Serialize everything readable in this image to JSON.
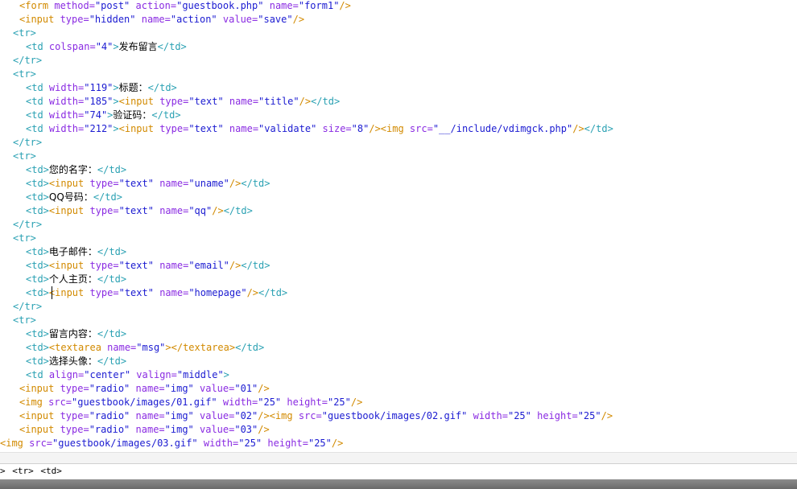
{
  "editor": {
    "lines": [
      [
        [
          "tag",
          "<form "
        ],
        [
          "attr",
          "method="
        ],
        [
          "val",
          "\"post\""
        ],
        [
          "tag",
          " "
        ],
        [
          "attr",
          "action="
        ],
        [
          "val",
          "\"guestbook.php\""
        ],
        [
          "tag",
          " "
        ],
        [
          "attr",
          "name="
        ],
        [
          "val",
          "\"form1\""
        ],
        [
          "tag",
          "/>"
        ]
      ],
      [
        [
          "tag",
          "<input "
        ],
        [
          "attr",
          "type="
        ],
        [
          "val",
          "\"hidden\""
        ],
        [
          "tag",
          " "
        ],
        [
          "attr",
          "name="
        ],
        [
          "val",
          "\"action\""
        ],
        [
          "tag",
          " "
        ],
        [
          "attr",
          "value="
        ],
        [
          "val",
          "\"save\""
        ],
        [
          "tag",
          "/>"
        ]
      ],
      [
        [
          "td",
          "<tr>"
        ]
      ],
      [
        [
          "td",
          "<td "
        ],
        [
          "attr",
          "colspan="
        ],
        [
          "val",
          "\"4\""
        ],
        [
          "td",
          ">"
        ],
        [
          "text",
          "发布留言"
        ],
        [
          "td",
          "</td>"
        ]
      ],
      [
        [
          "td",
          "</tr>"
        ]
      ],
      [
        [
          "td",
          "<tr>"
        ]
      ],
      [
        [
          "td",
          "<td "
        ],
        [
          "attr",
          "width="
        ],
        [
          "val",
          "\"119\""
        ],
        [
          "td",
          ">"
        ],
        [
          "text",
          "标题："
        ],
        [
          "td",
          "</td>"
        ]
      ],
      [
        [
          "td",
          "<td "
        ],
        [
          "attr",
          "width="
        ],
        [
          "val",
          "\"185\""
        ],
        [
          "td",
          ">"
        ],
        [
          "tag",
          "<input "
        ],
        [
          "attr",
          "type="
        ],
        [
          "val",
          "\"text\""
        ],
        [
          "tag",
          " "
        ],
        [
          "attr",
          "name="
        ],
        [
          "val",
          "\"title\""
        ],
        [
          "tag",
          "/>"
        ],
        [
          "td",
          "</td>"
        ]
      ],
      [
        [
          "td",
          "<td "
        ],
        [
          "attr",
          "width="
        ],
        [
          "val",
          "\"74\""
        ],
        [
          "td",
          ">"
        ],
        [
          "text",
          "验证码："
        ],
        [
          "td",
          "</td>"
        ]
      ],
      [
        [
          "td",
          "<td "
        ],
        [
          "attr",
          "width="
        ],
        [
          "val",
          "\"212\""
        ],
        [
          "td",
          ">"
        ],
        [
          "tag",
          "<input "
        ],
        [
          "attr",
          "type="
        ],
        [
          "val",
          "\"text\""
        ],
        [
          "tag",
          " "
        ],
        [
          "attr",
          "name="
        ],
        [
          "val",
          "\"validate\""
        ],
        [
          "tag",
          " "
        ],
        [
          "attr",
          "size="
        ],
        [
          "val",
          "\"8\""
        ],
        [
          "tag",
          "/><img "
        ],
        [
          "attr",
          "src="
        ],
        [
          "val",
          "\"__/include/vdimgck.php\""
        ],
        [
          "tag",
          "/>"
        ],
        [
          "td",
          "</td>"
        ]
      ],
      [
        [
          "td",
          "</tr>"
        ]
      ],
      [
        [
          "td",
          "<tr>"
        ]
      ],
      [
        [
          "td",
          "<td>"
        ],
        [
          "text",
          "您的名字："
        ],
        [
          "td",
          "</td>"
        ]
      ],
      [
        [
          "td",
          "<td>"
        ],
        [
          "tag",
          "<input "
        ],
        [
          "attr",
          "type="
        ],
        [
          "val",
          "\"text\""
        ],
        [
          "tag",
          " "
        ],
        [
          "attr",
          "name="
        ],
        [
          "val",
          "\"uname\""
        ],
        [
          "tag",
          "/>"
        ],
        [
          "td",
          "</td>"
        ]
      ],
      [
        [
          "td",
          "<td>"
        ],
        [
          "text",
          "QQ号码："
        ],
        [
          "td",
          "</td>"
        ]
      ],
      [
        [
          "td",
          "<td>"
        ],
        [
          "tag",
          "<input "
        ],
        [
          "attr",
          "type="
        ],
        [
          "val",
          "\"text\""
        ],
        [
          "tag",
          " "
        ],
        [
          "attr",
          "name="
        ],
        [
          "val",
          "\"qq\""
        ],
        [
          "tag",
          "/>"
        ],
        [
          "td",
          "</td>"
        ]
      ],
      [
        [
          "td",
          "</tr>"
        ]
      ],
      [
        [
          "td",
          "<tr>"
        ]
      ],
      [
        [
          "td",
          "<td>"
        ],
        [
          "text",
          "电子邮件："
        ],
        [
          "td",
          "</td>"
        ]
      ],
      [
        [
          "td",
          "<td>"
        ],
        [
          "tag",
          "<input "
        ],
        [
          "attr",
          "type="
        ],
        [
          "val",
          "\"text\""
        ],
        [
          "tag",
          " "
        ],
        [
          "attr",
          "name="
        ],
        [
          "val",
          "\"email\""
        ],
        [
          "tag",
          "/>"
        ],
        [
          "td",
          "</td>"
        ]
      ],
      [
        [
          "td",
          "<td>"
        ],
        [
          "text",
          "个人主页："
        ],
        [
          "td",
          "</td>"
        ]
      ],
      [
        [
          "td",
          "<td>"
        ],
        [
          "tag",
          "<input "
        ],
        [
          "attr",
          "type="
        ],
        [
          "val",
          "\"text\""
        ],
        [
          "tag",
          " "
        ],
        [
          "attr",
          "name="
        ],
        [
          "val",
          "\"homepage\""
        ],
        [
          "tag",
          "/>"
        ],
        [
          "td",
          "</td>"
        ]
      ],
      [
        [
          "td",
          "</tr>"
        ]
      ],
      [
        [
          "td",
          "<tr>"
        ]
      ],
      [
        [
          "td",
          "<td>"
        ],
        [
          "text",
          "留言内容："
        ],
        [
          "td",
          "</td>"
        ]
      ],
      [
        [
          "td",
          "<td>"
        ],
        [
          "tag",
          "<textarea "
        ],
        [
          "attr",
          "name="
        ],
        [
          "val",
          "\"msg\""
        ],
        [
          "tag",
          "></textarea>"
        ],
        [
          "td",
          "</td>"
        ]
      ],
      [
        [
          "td",
          "<td>"
        ],
        [
          "text",
          "选择头像："
        ],
        [
          "td",
          "</td>"
        ]
      ],
      [
        [
          "td",
          "<td "
        ],
        [
          "attr",
          "align="
        ],
        [
          "val",
          "\"center\""
        ],
        [
          "td",
          " "
        ],
        [
          "attr",
          "valign="
        ],
        [
          "val",
          "\"middle\""
        ],
        [
          "td",
          ">"
        ]
      ],
      [
        [
          "tag",
          "<input "
        ],
        [
          "attr",
          "type="
        ],
        [
          "val",
          "\"radio\""
        ],
        [
          "tag",
          " "
        ],
        [
          "attr",
          "name="
        ],
        [
          "val",
          "\"img\""
        ],
        [
          "tag",
          " "
        ],
        [
          "attr",
          "value="
        ],
        [
          "val",
          "\"01\""
        ],
        [
          "tag",
          "/>"
        ]
      ],
      [
        [
          "tag",
          "<img "
        ],
        [
          "attr",
          "src="
        ],
        [
          "val",
          "\"guestbook/images/01.gif\""
        ],
        [
          "tag",
          " "
        ],
        [
          "attr",
          "width="
        ],
        [
          "val",
          "\"25\""
        ],
        [
          "tag",
          " "
        ],
        [
          "attr",
          "height="
        ],
        [
          "val",
          "\"25\""
        ],
        [
          "tag",
          "/>"
        ]
      ],
      [
        [
          "tag",
          "<input "
        ],
        [
          "attr",
          "type="
        ],
        [
          "val",
          "\"radio\""
        ],
        [
          "tag",
          " "
        ],
        [
          "attr",
          "name="
        ],
        [
          "val",
          "\"img\""
        ],
        [
          "tag",
          " "
        ],
        [
          "attr",
          "value="
        ],
        [
          "val",
          "\"02\""
        ],
        [
          "tag",
          "/><img "
        ],
        [
          "attr",
          "src="
        ],
        [
          "val",
          "\"guestbook/images/02.gif\""
        ],
        [
          "tag",
          " "
        ],
        [
          "attr",
          "width="
        ],
        [
          "val",
          "\"25\""
        ],
        [
          "tag",
          " "
        ],
        [
          "attr",
          "height="
        ],
        [
          "val",
          "\"25\""
        ],
        [
          "tag",
          "/>"
        ]
      ],
      [
        [
          "tag",
          "<input "
        ],
        [
          "attr",
          "type="
        ],
        [
          "val",
          "\"radio\""
        ],
        [
          "tag",
          " "
        ],
        [
          "attr",
          "name="
        ],
        [
          "val",
          "\"img\""
        ],
        [
          "tag",
          " "
        ],
        [
          "attr",
          "value="
        ],
        [
          "val",
          "\"03\""
        ],
        [
          "tag",
          "/>"
        ]
      ],
      [
        [
          "tag",
          "<img "
        ],
        [
          "attr",
          "src="
        ],
        [
          "val",
          "\"guestbook/images/03.gif\""
        ],
        [
          "tag",
          " "
        ],
        [
          "attr",
          "width="
        ],
        [
          "val",
          "\"25\""
        ],
        [
          "tag",
          " "
        ],
        [
          "attr",
          "height="
        ],
        [
          "val",
          "\"25\""
        ],
        [
          "tag",
          "/>"
        ]
      ]
    ]
  },
  "tag_selector": {
    "items": [
      ">",
      "<tr>",
      "<td>"
    ]
  },
  "colors": {
    "tag": "#d28a00",
    "td_tag": "#2aa1b3",
    "attribute": "#8a2be2",
    "value": "#1b1bd1",
    "text": "#000000"
  }
}
